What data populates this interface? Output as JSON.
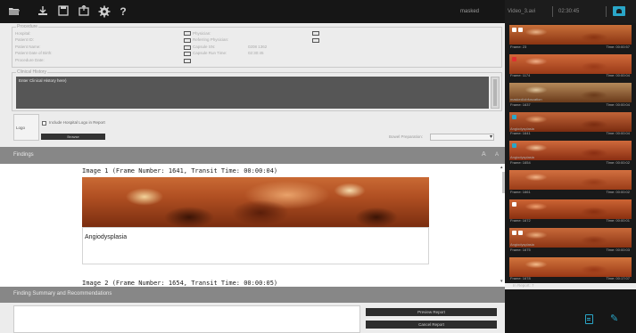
{
  "toolbar": {
    "icons": [
      "folder-open-icon",
      "download-icon",
      "save-icon",
      "export-icon",
      "settings-icon",
      "help-icon"
    ],
    "masked_label": "masked"
  },
  "video": {
    "name": "Video_3.avi",
    "time": "02:30:45"
  },
  "procedure": {
    "legend": "Procedure",
    "left_fields": [
      "Hospital:",
      "Patient ID:",
      "Patient Name:",
      "Patient Date of Birth:",
      "Procedure Date:"
    ],
    "right_fields": [
      "Physician:",
      "Referring Physician:",
      "Capsule SN:",
      "Capsule Run Time:"
    ],
    "capsule_sn": "0208 1362",
    "capsule_run_time": "02:30:45"
  },
  "clinical_history": {
    "legend": "Clinical History",
    "placeholder": "Enter Clinical History here)"
  },
  "logo": {
    "label": "Logo",
    "include_label": "Include Hospital Logo in Report",
    "browse_label": "Browse"
  },
  "bowel_prep": {
    "label": "Bowel Preparation:"
  },
  "findings": {
    "title": "Findings",
    "font_up": "A",
    "font_down": "A",
    "images": [
      {
        "title": "Image 1 (Frame Number: 1641, Transit Time: 00:00:04)",
        "description": "Angiodysplasia"
      },
      {
        "title": "Image 2 (Frame Number: 1654, Transit Time: 00:00:05)",
        "description": ""
      }
    ]
  },
  "summary": {
    "title": "Finding Summary and Recommendations"
  },
  "actions": {
    "preview": "Preview Report",
    "cancel": "Cancel Report"
  },
  "thumbnails": [
    {
      "caption": "",
      "frame": "Frame: 23",
      "time": "Time: 00:00:57"
    },
    {
      "caption": "",
      "frame": "Frame: 1174",
      "time": "Time: 00:00:04"
    },
    {
      "caption": "masked/obfuscation",
      "frame": "Frame: 1637",
      "time": "Time: 00:00:04"
    },
    {
      "caption": "Angiodysplasia",
      "frame": "Frame: 1641",
      "time": "Time: 00:00:04"
    },
    {
      "caption": "Angiodysplasia",
      "frame": "Frame: 1654",
      "time": "Time: 00:00:02"
    },
    {
      "caption": "",
      "frame": "Frame: 1661",
      "time": "Time: 00:00:02"
    },
    {
      "caption": "",
      "frame": "Frame: 1672",
      "time": "Time: 00:00:01"
    },
    {
      "caption": "Angiodysplasia",
      "frame": "Frame: 1675",
      "time": "Time: 00:00:03"
    },
    {
      "caption": "",
      "frame": "Frame: 1678",
      "time": "Time: 00:17:07"
    }
  ],
  "in_report": "In Report: 7"
}
